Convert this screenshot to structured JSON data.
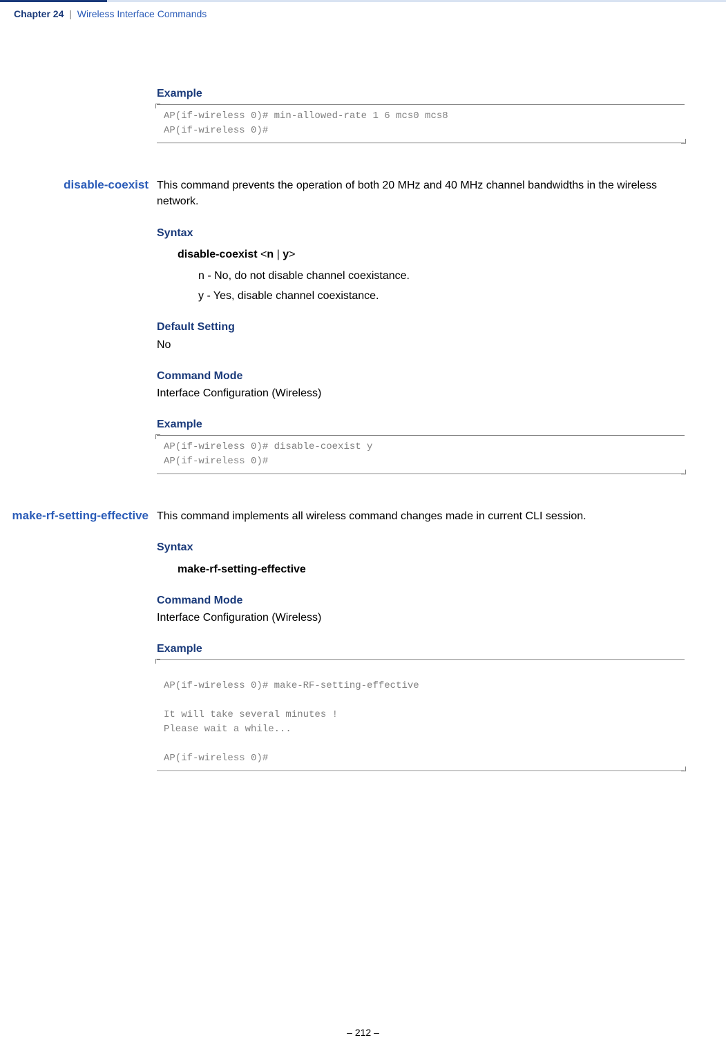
{
  "header": {
    "chapter": "Chapter 24",
    "separator": "|",
    "title": "Wireless Interface Commands"
  },
  "section1": {
    "example_label": "Example",
    "code": "AP(if-wireless 0)# min-allowed-rate 1 6 mcs0 mcs8\nAP(if-wireless 0)#"
  },
  "section2": {
    "name": "disable-coexist",
    "desc": "This command prevents the operation of both 20 MHz and 40 MHz channel bandwidths in the wireless network.",
    "syntax_label": "Syntax",
    "syntax_cmd": "disable-coexist",
    "syntax_args_open": " <",
    "syntax_arg_n": "n",
    "syntax_pipe": " | ",
    "syntax_arg_y": "y",
    "syntax_args_close": ">",
    "param_n_key": "n",
    "param_n_desc": " - No, do not disable channel coexistance.",
    "param_y_key": "y",
    "param_y_desc": " - Yes, disable channel coexistance.",
    "default_label": "Default Setting",
    "default_value": "No",
    "mode_label": "Command Mode",
    "mode_value": "Interface Configuration (Wireless)",
    "example_label": "Example",
    "code": "AP(if-wireless 0)# disable-coexist y\nAP(if-wireless 0)#"
  },
  "section3": {
    "name": "make-rf-setting-effective",
    "desc": "This command implements all wireless command changes made in current CLI session.",
    "syntax_label": "Syntax",
    "syntax_cmd": "make-rf-setting-effective",
    "mode_label": "Command Mode",
    "mode_value": "Interface Configuration (Wireless)",
    "example_label": "Example",
    "code": "\nAP(if-wireless 0)# make-RF-setting-effective\n\nIt will take several minutes !\nPlease wait a while...\n\nAP(if-wireless 0)#"
  },
  "footer": {
    "page": "–  212  –"
  }
}
